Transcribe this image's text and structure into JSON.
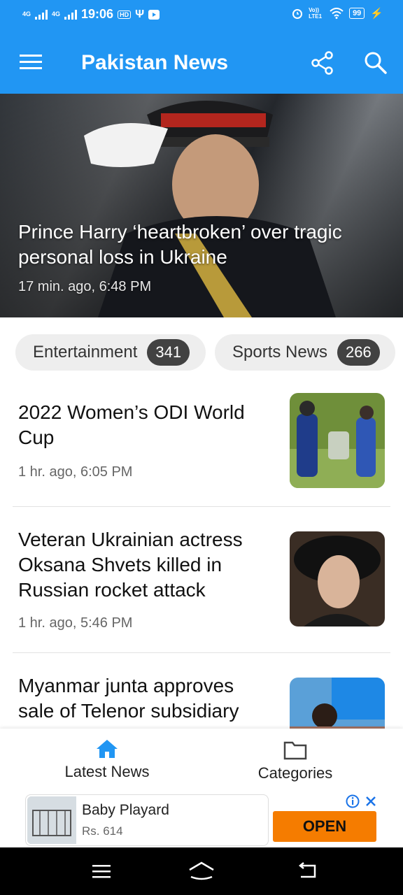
{
  "status_bar": {
    "network1": "4G",
    "network2": "4G",
    "time": "19:06",
    "battery": "99",
    "volte": "Vo)) LTE1"
  },
  "app_bar": {
    "title": "Pakistan News",
    "icons": [
      "menu-icon",
      "share-icon",
      "search-icon"
    ]
  },
  "hero": {
    "title": "Prince Harry ‘heartbroken’ over tragic personal loss in Ukraine",
    "time": "17 min. ago, 6:48 PM"
  },
  "categories": [
    {
      "label": "Entertainment",
      "count": "341"
    },
    {
      "label": "Sports News",
      "count": "266"
    }
  ],
  "articles": [
    {
      "title": "2022 Women’s ODI World Cup",
      "time": "1 hr. ago, 6:05 PM"
    },
    {
      "title": "Veteran Ukrainian actress Oksana Shvets killed in Russian rocket attack",
      "time": "1 hr. ago, 5:46 PM"
    },
    {
      "title": "Myanmar junta approves sale of Telenor subsidiary",
      "time": ""
    }
  ],
  "bottom_nav": {
    "items": [
      {
        "label": "Latest News",
        "icon": "home-icon",
        "active": true
      },
      {
        "label": "Categories",
        "icon": "folder-icon",
        "active": false
      }
    ],
    "accent": "#2196f3"
  },
  "ad": {
    "title": "Baby Playard",
    "price": "Rs. 614",
    "cta": "OPEN",
    "cta_color": "#f57c00"
  },
  "colors": {
    "primary": "#2196f3",
    "chip_bg": "#eeeeee",
    "badge_bg": "#424242"
  }
}
